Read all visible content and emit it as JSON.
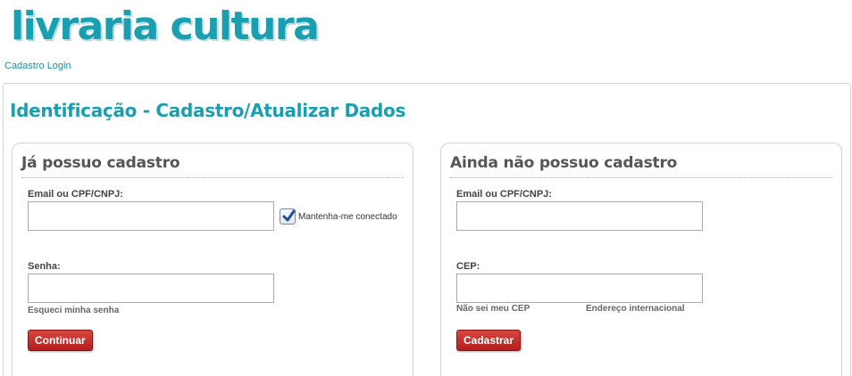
{
  "brand": {
    "logo_text": "livraria cultura",
    "accent_color": "#1a9fb0",
    "button_color": "#b21e1e"
  },
  "breadcrumb": {
    "label": "Cadastro Login"
  },
  "page": {
    "title": "Identificação - Cadastro/Atualizar Dados"
  },
  "login_panel": {
    "heading": "Já possuo cadastro",
    "email_label": "Email ou CPF/CNPJ:",
    "email_value": "",
    "remember_checked": true,
    "remember_label": "Mantenha-me conectado",
    "password_label": "Senha:",
    "password_value": "",
    "forgot_link": "Esqueci minha senha",
    "submit_label": "Continuar"
  },
  "register_panel": {
    "heading": "Ainda não possuo cadastro",
    "email_label": "Email ou CPF/CNPJ:",
    "email_value": "",
    "cep_label": "CEP:",
    "cep_value": "",
    "unknown_cep_link": "Não sei meu CEP",
    "international_link": "Endereço internacional",
    "submit_label": "Cadastrar"
  }
}
